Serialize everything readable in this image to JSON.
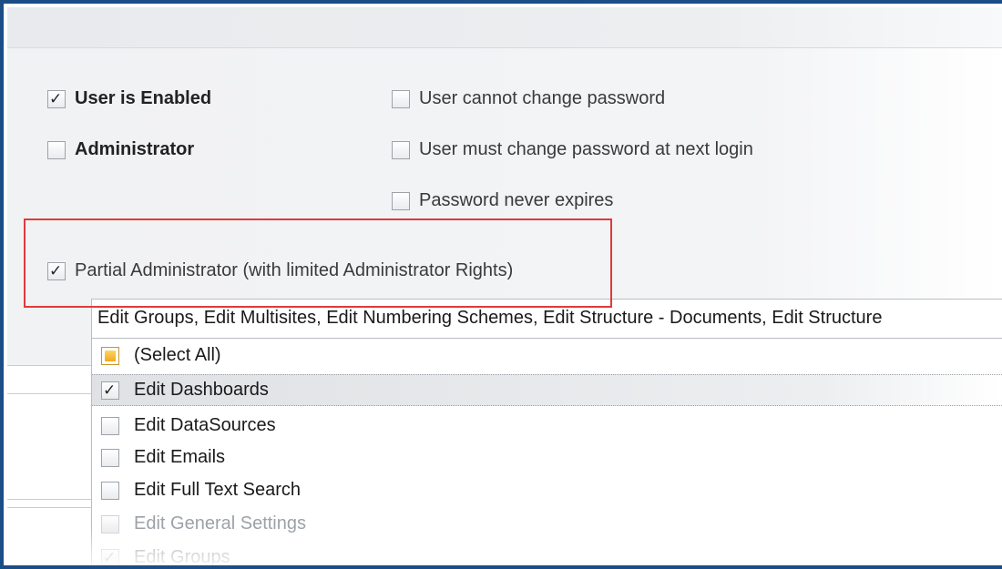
{
  "options": {
    "user_enabled": {
      "label": "User is Enabled",
      "checked": true
    },
    "administrator": {
      "label": "Administrator",
      "checked": false
    },
    "cannot_change_password": {
      "label": "User cannot change password",
      "checked": false
    },
    "must_change_password": {
      "label": "User must change password at next login",
      "checked": false
    },
    "password_never_expires": {
      "label": "Password never expires",
      "checked": false
    },
    "partial_admin": {
      "label": "Partial Administrator (with limited Administrator Rights)",
      "checked": true
    }
  },
  "rights": {
    "summary": "Edit Groups, Edit Multisites, Edit Numbering Schemes, Edit Structure - Documents, Edit Structure",
    "items": [
      {
        "label": "(Select All)",
        "state": "partial"
      },
      {
        "label": "Edit Dashboards",
        "state": "checked"
      },
      {
        "label": "Edit DataSources",
        "state": "unchecked"
      },
      {
        "label": "Edit Emails",
        "state": "unchecked"
      },
      {
        "label": "Edit Full Text Search",
        "state": "unchecked"
      },
      {
        "label": "Edit General Settings",
        "state": "unchecked"
      },
      {
        "label": "Edit Groups",
        "state": "checked"
      }
    ]
  },
  "colors": {
    "frame_border": "#1b4e86",
    "highlight_border": "#e03a3a",
    "select_all_indicator": "#f2a81c"
  }
}
